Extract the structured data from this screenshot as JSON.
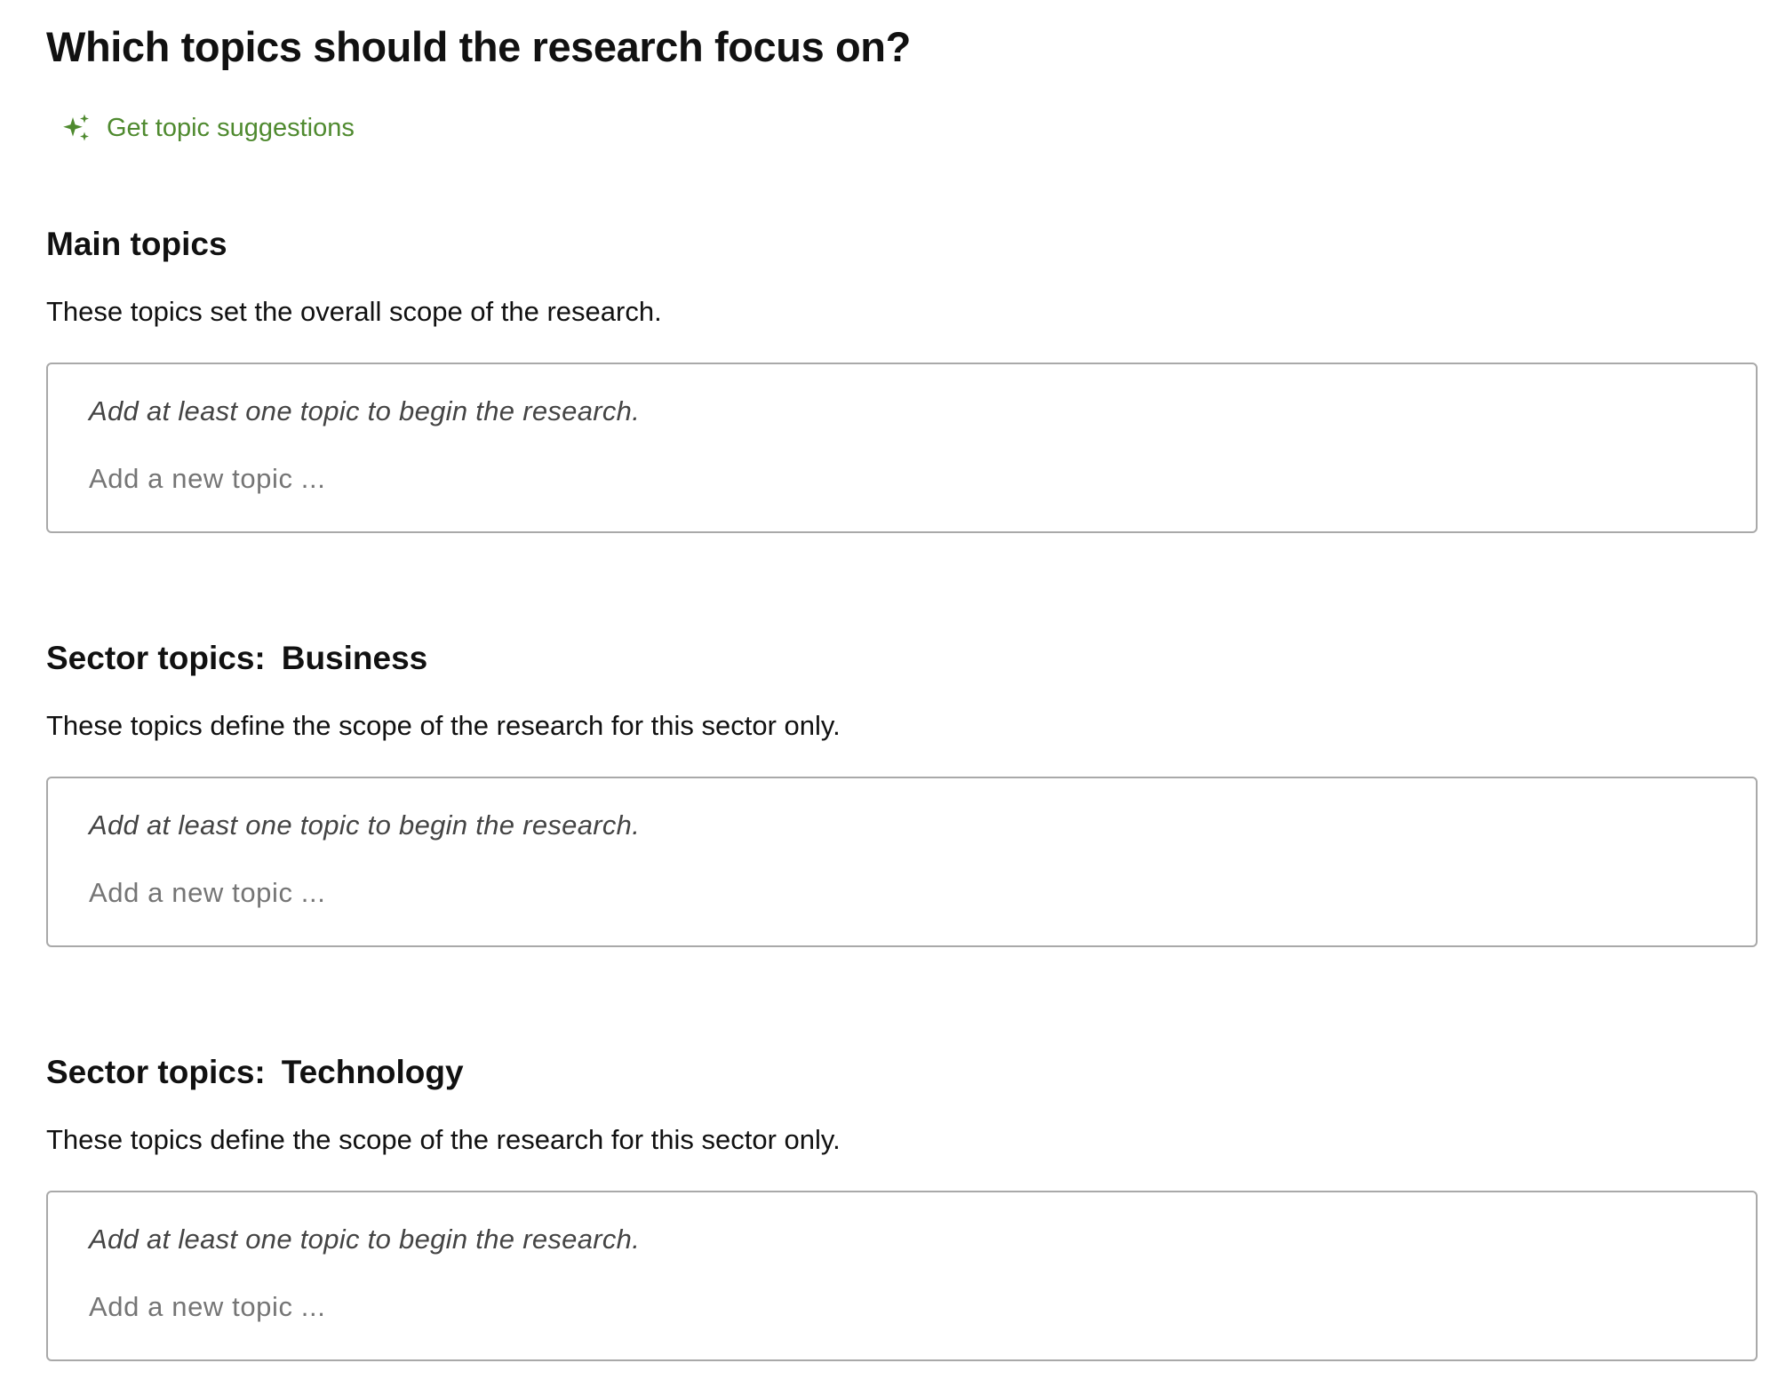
{
  "page_title": "Which topics should the research focus on?",
  "suggestions": {
    "label": "Get topic suggestions",
    "icon": "sparkles-icon",
    "color": "#4f8a2f"
  },
  "sections": [
    {
      "title": "Main topics",
      "sector_name": "",
      "description": "These topics set the overall scope of the research.",
      "empty_hint": "Add at least one topic to begin the research.",
      "input_placeholder": "Add a new topic ...",
      "input_value": ""
    },
    {
      "title": "Sector topics:",
      "sector_name": "Business",
      "description": "These topics define the scope of the research for this sector only.",
      "empty_hint": "Add at least one topic to begin the research.",
      "input_placeholder": "Add a new topic ...",
      "input_value": ""
    },
    {
      "title": "Sector topics:",
      "sector_name": "Technology",
      "description": "These topics define the scope of the research for this sector only.",
      "empty_hint": "Add at least one topic to begin the research.",
      "input_placeholder": "Add a new topic ...",
      "input_value": ""
    }
  ]
}
